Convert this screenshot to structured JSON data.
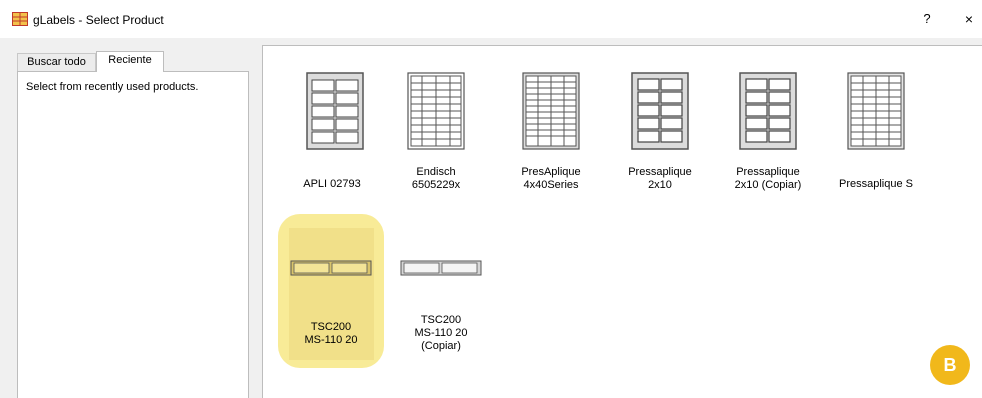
{
  "window": {
    "title": "gLabels - Select Product",
    "help_label": "?",
    "close_label": "×"
  },
  "tabs": [
    {
      "label": "Buscar todo",
      "active": false
    },
    {
      "label": "Reciente",
      "active": true
    }
  ],
  "left_panel": {
    "description": "Select from recently used products."
  },
  "products": [
    {
      "label": "APLI 02793",
      "icon": "label-sheet-2x5-icon"
    },
    {
      "label": "Endisch\n6505229x",
      "icon": "label-sheet-4x10-icon"
    },
    {
      "label": "PresAplique\n4x40Series",
      "icon": "label-sheet-4x12-icon"
    },
    {
      "label": "Pressaplique\n2x10",
      "icon": "label-sheet-2x5-icon"
    },
    {
      "label": "Pressaplique\n2x10 (Copiar)",
      "icon": "label-sheet-2x5-icon"
    },
    {
      "label": "Pressaplique S",
      "icon": "label-sheet-4x10-icon"
    },
    {
      "label": "TSC200\nMS-110 20",
      "icon": "label-strip-2-icon",
      "highlighted": true
    },
    {
      "label": "TSC200\nMS-110 20\n(Copiar)",
      "icon": "label-strip-2-icon"
    }
  ],
  "badge": {
    "text": "B",
    "color": "#f1b81b"
  },
  "colors": {
    "highlight": "#f7e98c",
    "window_bg": "#f0f0f0"
  }
}
